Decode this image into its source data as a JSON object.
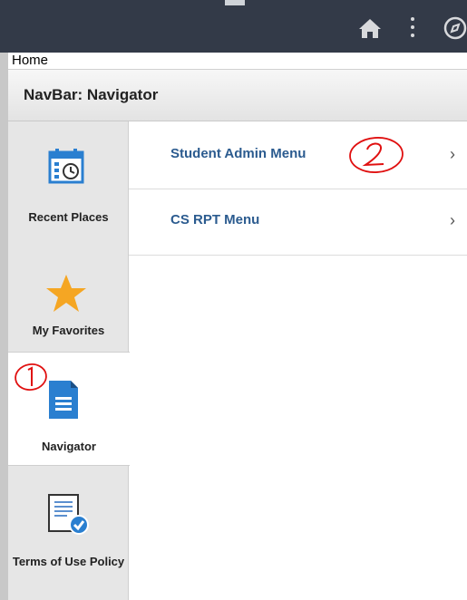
{
  "breadcrumb": "Home",
  "page_title": "NavBar: Navigator",
  "sidebar": {
    "items": [
      {
        "label": "Recent Places"
      },
      {
        "label": "My Favorites"
      },
      {
        "label": "Navigator"
      },
      {
        "label": "Terms of Use Policy"
      }
    ]
  },
  "menu": {
    "items": [
      {
        "label": "Student Admin Menu",
        "chevron": "›"
      },
      {
        "label": "CS RPT Menu",
        "chevron": "›"
      }
    ]
  },
  "annotations": {
    "one": "1",
    "two": "2"
  },
  "colors": {
    "topbar": "#333a48",
    "link": "#2b5b8f",
    "icon_blue": "#2a7fd0",
    "star": "#f5a623",
    "annotation": "#e01010"
  }
}
